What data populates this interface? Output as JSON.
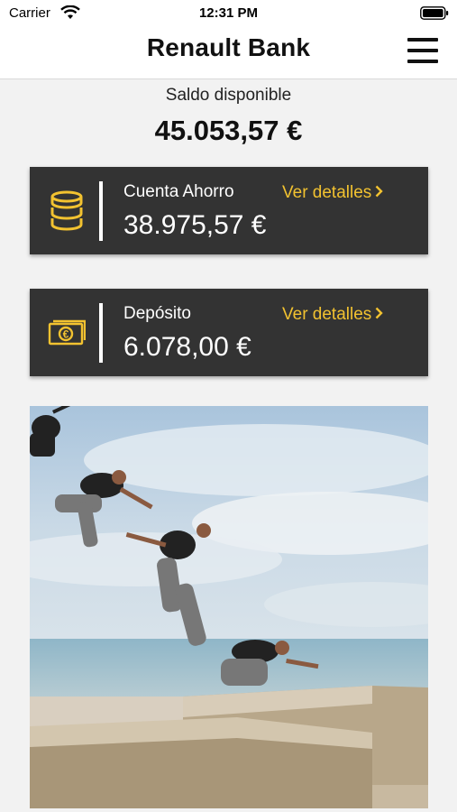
{
  "status_bar": {
    "carrier": "Carrier",
    "time": "12:31 PM",
    "wifi_icon": "wifi-icon",
    "battery_icon": "battery-icon"
  },
  "nav": {
    "title": "Renault Bank",
    "menu_icon": "hamburger-menu-icon"
  },
  "balance": {
    "label": "Saldo disponible",
    "value": "45.053,57 €"
  },
  "accounts": [
    {
      "name": "Cuenta Ahorro",
      "amount": "38.975,57 €",
      "details_label": "Ver detalles",
      "icon": "coins-stack-icon"
    },
    {
      "name": "Depósito",
      "amount": "6.078,00 €",
      "details_label": "Ver detalles",
      "icon": "euro-banknote-icon"
    }
  ],
  "promo_image": {
    "description_icon": "parkour-jump-photo"
  },
  "colors": {
    "accent": "#f2c230",
    "card_bg": "#333333",
    "page_bg": "#f2f2f2"
  }
}
